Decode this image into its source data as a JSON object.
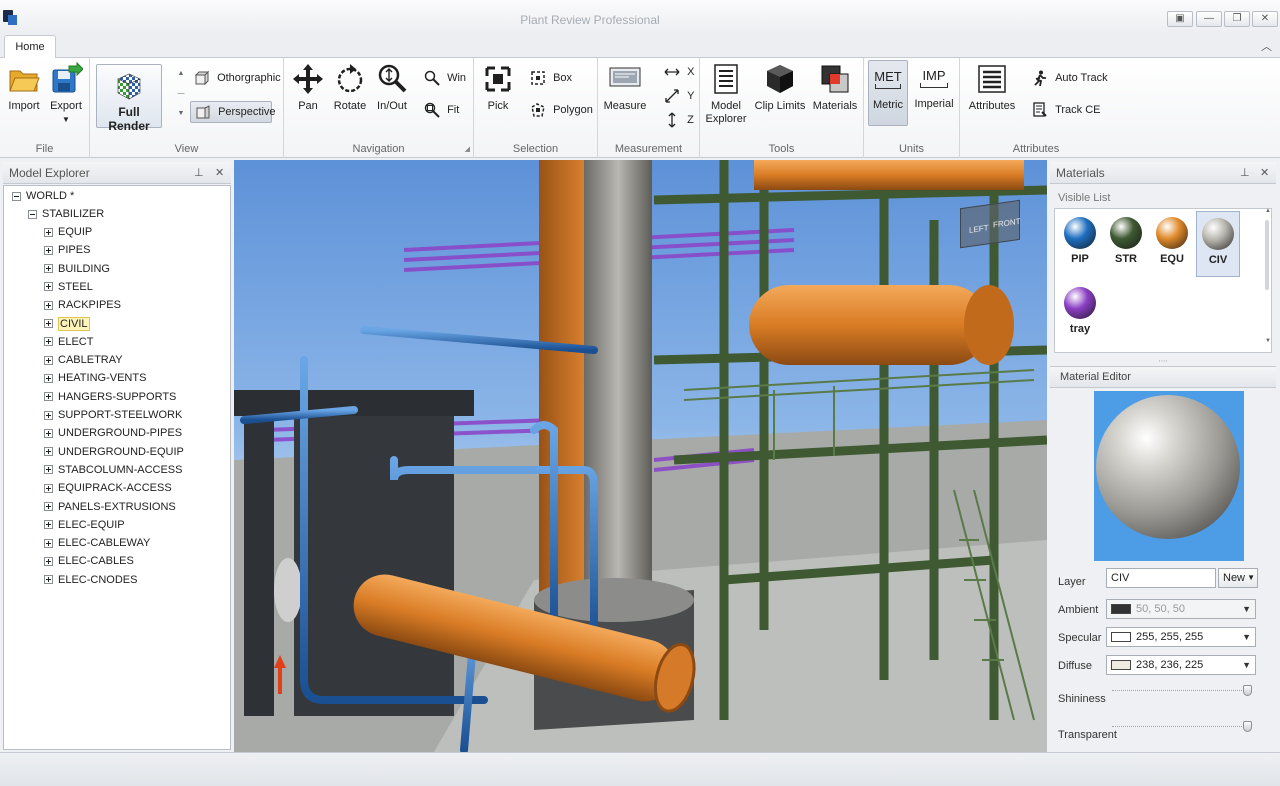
{
  "app": {
    "title": "Plant Review Professional"
  },
  "tabs": [
    {
      "label": "Home"
    }
  ],
  "ribbon": {
    "file": {
      "label": "File",
      "import": "Import",
      "export": "Export"
    },
    "view": {
      "label": "View",
      "full_render": "Full Render",
      "orthographic": "Othorgraphic",
      "perspective": "Perspective"
    },
    "navigation": {
      "label": "Navigation",
      "pan": "Pan",
      "rotate": "Rotate",
      "inout": "In/Out",
      "win": "Win",
      "fit": "Fit"
    },
    "selection": {
      "label": "Selection",
      "pick": "Pick",
      "box": "Box",
      "polygon": "Polygon"
    },
    "measurement": {
      "label": "Measurement",
      "measure": "Measure",
      "x": "X",
      "y": "Y",
      "z": "Z"
    },
    "tools": {
      "label": "Tools",
      "model_explorer_1": "Model",
      "model_explorer_2": "Explorer",
      "clip_limits": "Clip Limits",
      "materials": "Materials"
    },
    "units": {
      "label": "Units",
      "metric_icon": "MET",
      "metric": "Metric",
      "imperial_icon": "IMP",
      "imperial": "Imperial"
    },
    "attributes": {
      "label": "Attributes",
      "attributes": "Attributes",
      "auto_track": "Auto Track",
      "track_ce": "Track CE"
    }
  },
  "model_explorer": {
    "title": "Model Explorer",
    "root": "WORLD *",
    "child": "STABILIZER",
    "items": [
      "EQUIP",
      "PIPES",
      "BUILDING",
      "STEEL",
      "RACKPIPES",
      "CIVIL",
      "ELECT",
      "CABLETRAY",
      "HEATING-VENTS",
      "HANGERS-SUPPORTS",
      "SUPPORT-STEELWORK",
      "UNDERGROUND-PIPES",
      "UNDERGROUND-EQUIP",
      "STABCOLUMN-ACCESS",
      "EQUIPRACK-ACCESS",
      "PANELS-EXTRUSIONS",
      "ELEC-EQUIP",
      "ELEC-CABLEWAY",
      "ELEC-CABLES",
      "ELEC-CNODES"
    ],
    "selected": "CIVIL"
  },
  "viewcube": {
    "left": "LEFT",
    "front": "FRONT"
  },
  "materials": {
    "title": "Materials",
    "visible_list_label": "Visible List",
    "swatches": [
      {
        "name": "PIP",
        "color": "#1f6fc0"
      },
      {
        "name": "STR",
        "color": "#3f5a32"
      },
      {
        "name": "EQU",
        "color": "#e08a2a"
      },
      {
        "name": "CIV",
        "color": "#b8b6ae"
      },
      {
        "name": "tray",
        "color": "#8b3fc4"
      }
    ],
    "selected": "CIV",
    "editor_title": "Material Editor",
    "layer_label": "Layer",
    "layer_value": "CIV",
    "new_button": "New",
    "ambient_label": "Ambient",
    "ambient_value": "50, 50, 50",
    "ambient_color": "#323232",
    "specular_label": "Specular",
    "specular_value": "255, 255, 255",
    "specular_color": "#ffffff",
    "diffuse_label": "Diffuse",
    "diffuse_value": "238, 236, 225",
    "diffuse_color": "#eeece1",
    "shininess_label": "Shininess",
    "transparent_label": "Transparent"
  }
}
